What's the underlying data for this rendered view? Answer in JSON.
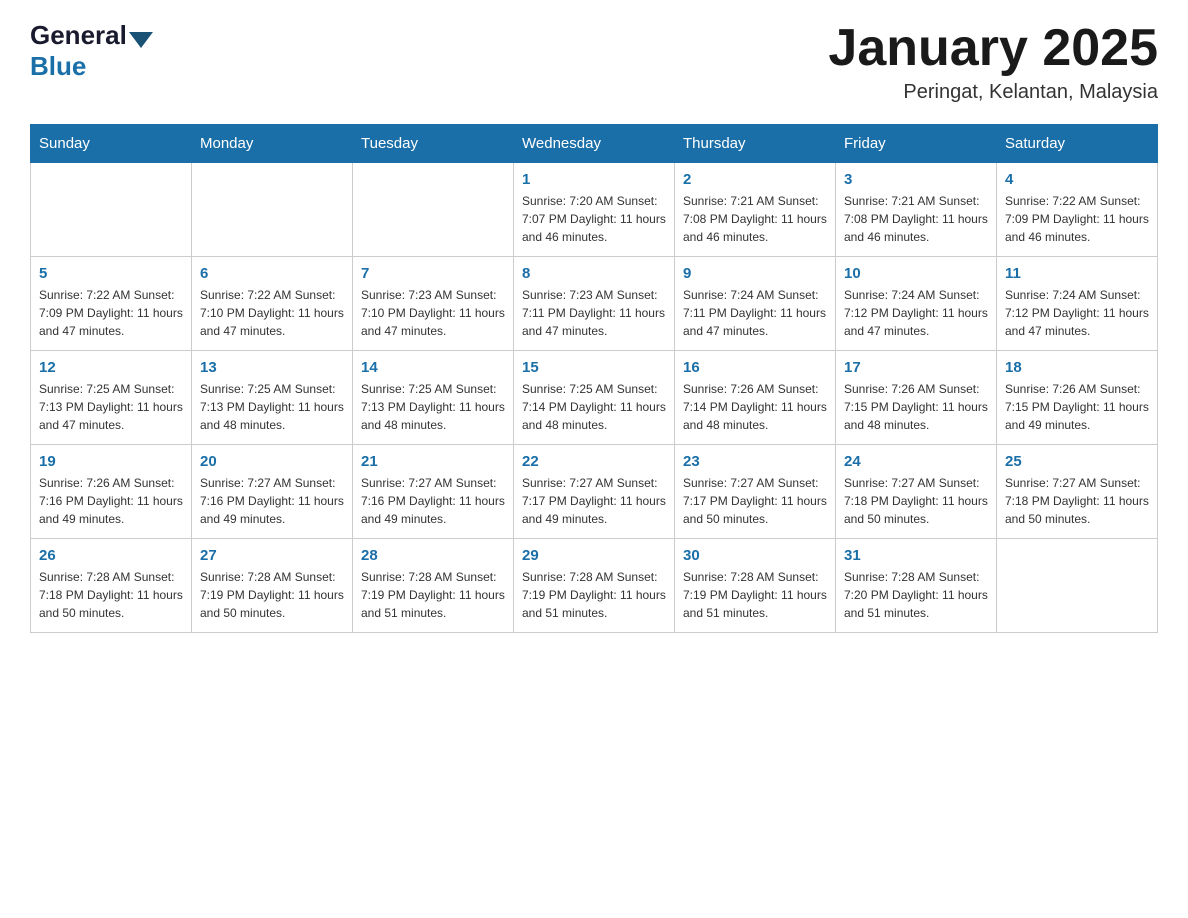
{
  "header": {
    "logo_general": "General",
    "logo_blue": "Blue",
    "month_title": "January 2025",
    "location": "Peringat, Kelantan, Malaysia"
  },
  "days_of_week": [
    "Sunday",
    "Monday",
    "Tuesday",
    "Wednesday",
    "Thursday",
    "Friday",
    "Saturday"
  ],
  "weeks": [
    [
      {
        "day": "",
        "info": ""
      },
      {
        "day": "",
        "info": ""
      },
      {
        "day": "",
        "info": ""
      },
      {
        "day": "1",
        "info": "Sunrise: 7:20 AM\nSunset: 7:07 PM\nDaylight: 11 hours\nand 46 minutes."
      },
      {
        "day": "2",
        "info": "Sunrise: 7:21 AM\nSunset: 7:08 PM\nDaylight: 11 hours\nand 46 minutes."
      },
      {
        "day": "3",
        "info": "Sunrise: 7:21 AM\nSunset: 7:08 PM\nDaylight: 11 hours\nand 46 minutes."
      },
      {
        "day": "4",
        "info": "Sunrise: 7:22 AM\nSunset: 7:09 PM\nDaylight: 11 hours\nand 46 minutes."
      }
    ],
    [
      {
        "day": "5",
        "info": "Sunrise: 7:22 AM\nSunset: 7:09 PM\nDaylight: 11 hours\nand 47 minutes."
      },
      {
        "day": "6",
        "info": "Sunrise: 7:22 AM\nSunset: 7:10 PM\nDaylight: 11 hours\nand 47 minutes."
      },
      {
        "day": "7",
        "info": "Sunrise: 7:23 AM\nSunset: 7:10 PM\nDaylight: 11 hours\nand 47 minutes."
      },
      {
        "day": "8",
        "info": "Sunrise: 7:23 AM\nSunset: 7:11 PM\nDaylight: 11 hours\nand 47 minutes."
      },
      {
        "day": "9",
        "info": "Sunrise: 7:24 AM\nSunset: 7:11 PM\nDaylight: 11 hours\nand 47 minutes."
      },
      {
        "day": "10",
        "info": "Sunrise: 7:24 AM\nSunset: 7:12 PM\nDaylight: 11 hours\nand 47 minutes."
      },
      {
        "day": "11",
        "info": "Sunrise: 7:24 AM\nSunset: 7:12 PM\nDaylight: 11 hours\nand 47 minutes."
      }
    ],
    [
      {
        "day": "12",
        "info": "Sunrise: 7:25 AM\nSunset: 7:13 PM\nDaylight: 11 hours\nand 47 minutes."
      },
      {
        "day": "13",
        "info": "Sunrise: 7:25 AM\nSunset: 7:13 PM\nDaylight: 11 hours\nand 48 minutes."
      },
      {
        "day": "14",
        "info": "Sunrise: 7:25 AM\nSunset: 7:13 PM\nDaylight: 11 hours\nand 48 minutes."
      },
      {
        "day": "15",
        "info": "Sunrise: 7:25 AM\nSunset: 7:14 PM\nDaylight: 11 hours\nand 48 minutes."
      },
      {
        "day": "16",
        "info": "Sunrise: 7:26 AM\nSunset: 7:14 PM\nDaylight: 11 hours\nand 48 minutes."
      },
      {
        "day": "17",
        "info": "Sunrise: 7:26 AM\nSunset: 7:15 PM\nDaylight: 11 hours\nand 48 minutes."
      },
      {
        "day": "18",
        "info": "Sunrise: 7:26 AM\nSunset: 7:15 PM\nDaylight: 11 hours\nand 49 minutes."
      }
    ],
    [
      {
        "day": "19",
        "info": "Sunrise: 7:26 AM\nSunset: 7:16 PM\nDaylight: 11 hours\nand 49 minutes."
      },
      {
        "day": "20",
        "info": "Sunrise: 7:27 AM\nSunset: 7:16 PM\nDaylight: 11 hours\nand 49 minutes."
      },
      {
        "day": "21",
        "info": "Sunrise: 7:27 AM\nSunset: 7:16 PM\nDaylight: 11 hours\nand 49 minutes."
      },
      {
        "day": "22",
        "info": "Sunrise: 7:27 AM\nSunset: 7:17 PM\nDaylight: 11 hours\nand 49 minutes."
      },
      {
        "day": "23",
        "info": "Sunrise: 7:27 AM\nSunset: 7:17 PM\nDaylight: 11 hours\nand 50 minutes."
      },
      {
        "day": "24",
        "info": "Sunrise: 7:27 AM\nSunset: 7:18 PM\nDaylight: 11 hours\nand 50 minutes."
      },
      {
        "day": "25",
        "info": "Sunrise: 7:27 AM\nSunset: 7:18 PM\nDaylight: 11 hours\nand 50 minutes."
      }
    ],
    [
      {
        "day": "26",
        "info": "Sunrise: 7:28 AM\nSunset: 7:18 PM\nDaylight: 11 hours\nand 50 minutes."
      },
      {
        "day": "27",
        "info": "Sunrise: 7:28 AM\nSunset: 7:19 PM\nDaylight: 11 hours\nand 50 minutes."
      },
      {
        "day": "28",
        "info": "Sunrise: 7:28 AM\nSunset: 7:19 PM\nDaylight: 11 hours\nand 51 minutes."
      },
      {
        "day": "29",
        "info": "Sunrise: 7:28 AM\nSunset: 7:19 PM\nDaylight: 11 hours\nand 51 minutes."
      },
      {
        "day": "30",
        "info": "Sunrise: 7:28 AM\nSunset: 7:19 PM\nDaylight: 11 hours\nand 51 minutes."
      },
      {
        "day": "31",
        "info": "Sunrise: 7:28 AM\nSunset: 7:20 PM\nDaylight: 11 hours\nand 51 minutes."
      },
      {
        "day": "",
        "info": ""
      }
    ]
  ]
}
